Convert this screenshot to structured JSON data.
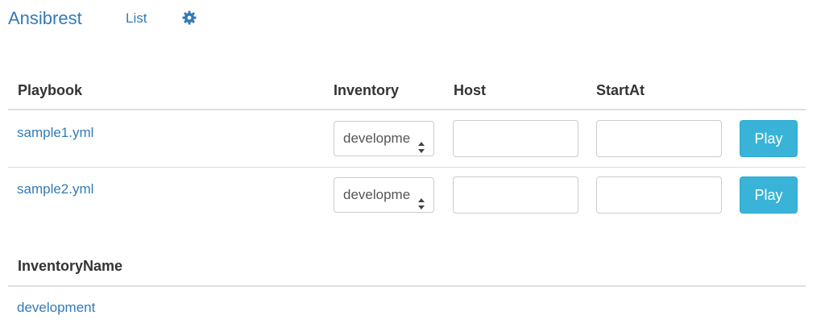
{
  "navbar": {
    "brand": "Ansibrest",
    "list_label": "List",
    "settings_icon": "gear-icon"
  },
  "playbooks_table": {
    "headers": {
      "playbook": "Playbook",
      "inventory": "Inventory",
      "host": "Host",
      "start_at": "StartAt"
    },
    "rows": [
      {
        "playbook": "sample1.yml",
        "inventory_selected": "development",
        "host_value": "",
        "start_at_value": "",
        "play_label": "Play"
      },
      {
        "playbook": "sample2.yml",
        "inventory_selected": "development",
        "host_value": "",
        "start_at_value": "",
        "play_label": "Play"
      }
    ]
  },
  "inventories_table": {
    "header": "InventoryName",
    "rows": [
      {
        "name": "development"
      }
    ]
  },
  "colors": {
    "link": "#337ab7",
    "play_button": "#39b3d7",
    "border": "#dddddd"
  }
}
